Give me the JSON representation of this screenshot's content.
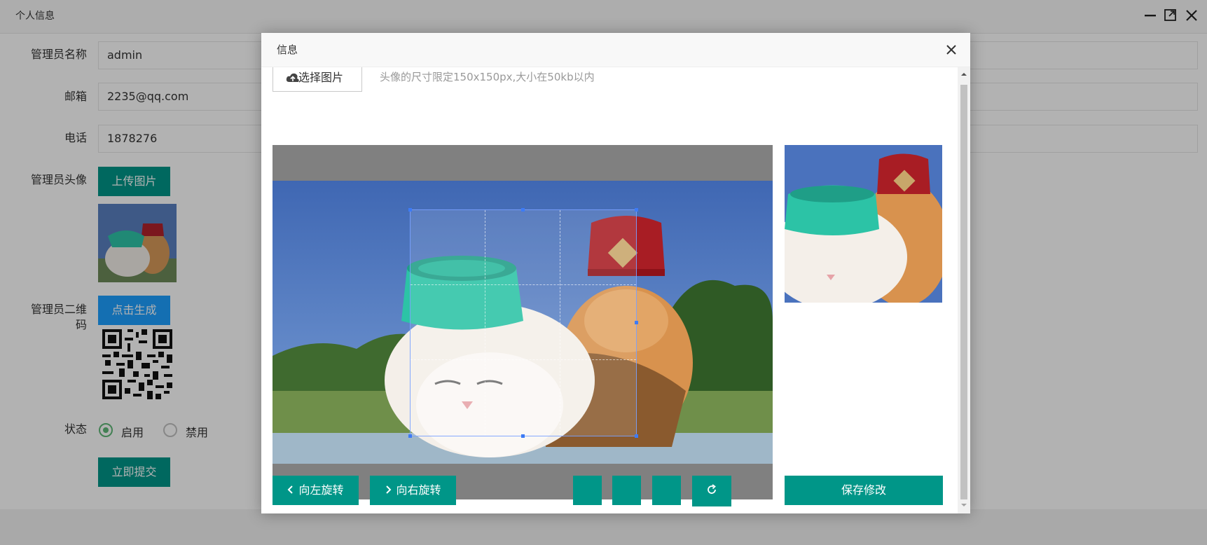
{
  "window": {
    "title": "个人信息",
    "controls": [
      "minimize-icon",
      "maximize-icon",
      "close-icon"
    ]
  },
  "form": {
    "name_label": "管理员名称",
    "name_value": "admin",
    "email_label": "邮箱",
    "email_value": "2235@qq.com",
    "phone_label": "电话",
    "phone_value": "1878276",
    "avatar_label": "管理员头像",
    "upload_button": "上传图片",
    "qrcode_label_line1": "管理员二维",
    "qrcode_label_line2": "码",
    "generate_button": "点击生成",
    "status_label": "状态",
    "status_options": [
      {
        "label": "启用",
        "checked": true
      },
      {
        "label": "禁用",
        "checked": false
      }
    ],
    "submit_button": "立即提交"
  },
  "modal": {
    "title": "信息",
    "choose_button": "选择图片",
    "hint": "头像的尺寸限定150x150px,大小在50kb以内",
    "rotate_left": "向左旋转",
    "rotate_right": "向右旋转",
    "save_button": "保存修改",
    "icons": {
      "close": "close-icon",
      "choose": "cloud-upload-icon",
      "rotate_left": "chevron-left-icon",
      "rotate_right": "chevron-right-icon",
      "reset": "refresh-icon"
    }
  },
  "colors": {
    "teal": "#009688",
    "blue": "#1e9fff",
    "radio_green": "#5fb878"
  }
}
